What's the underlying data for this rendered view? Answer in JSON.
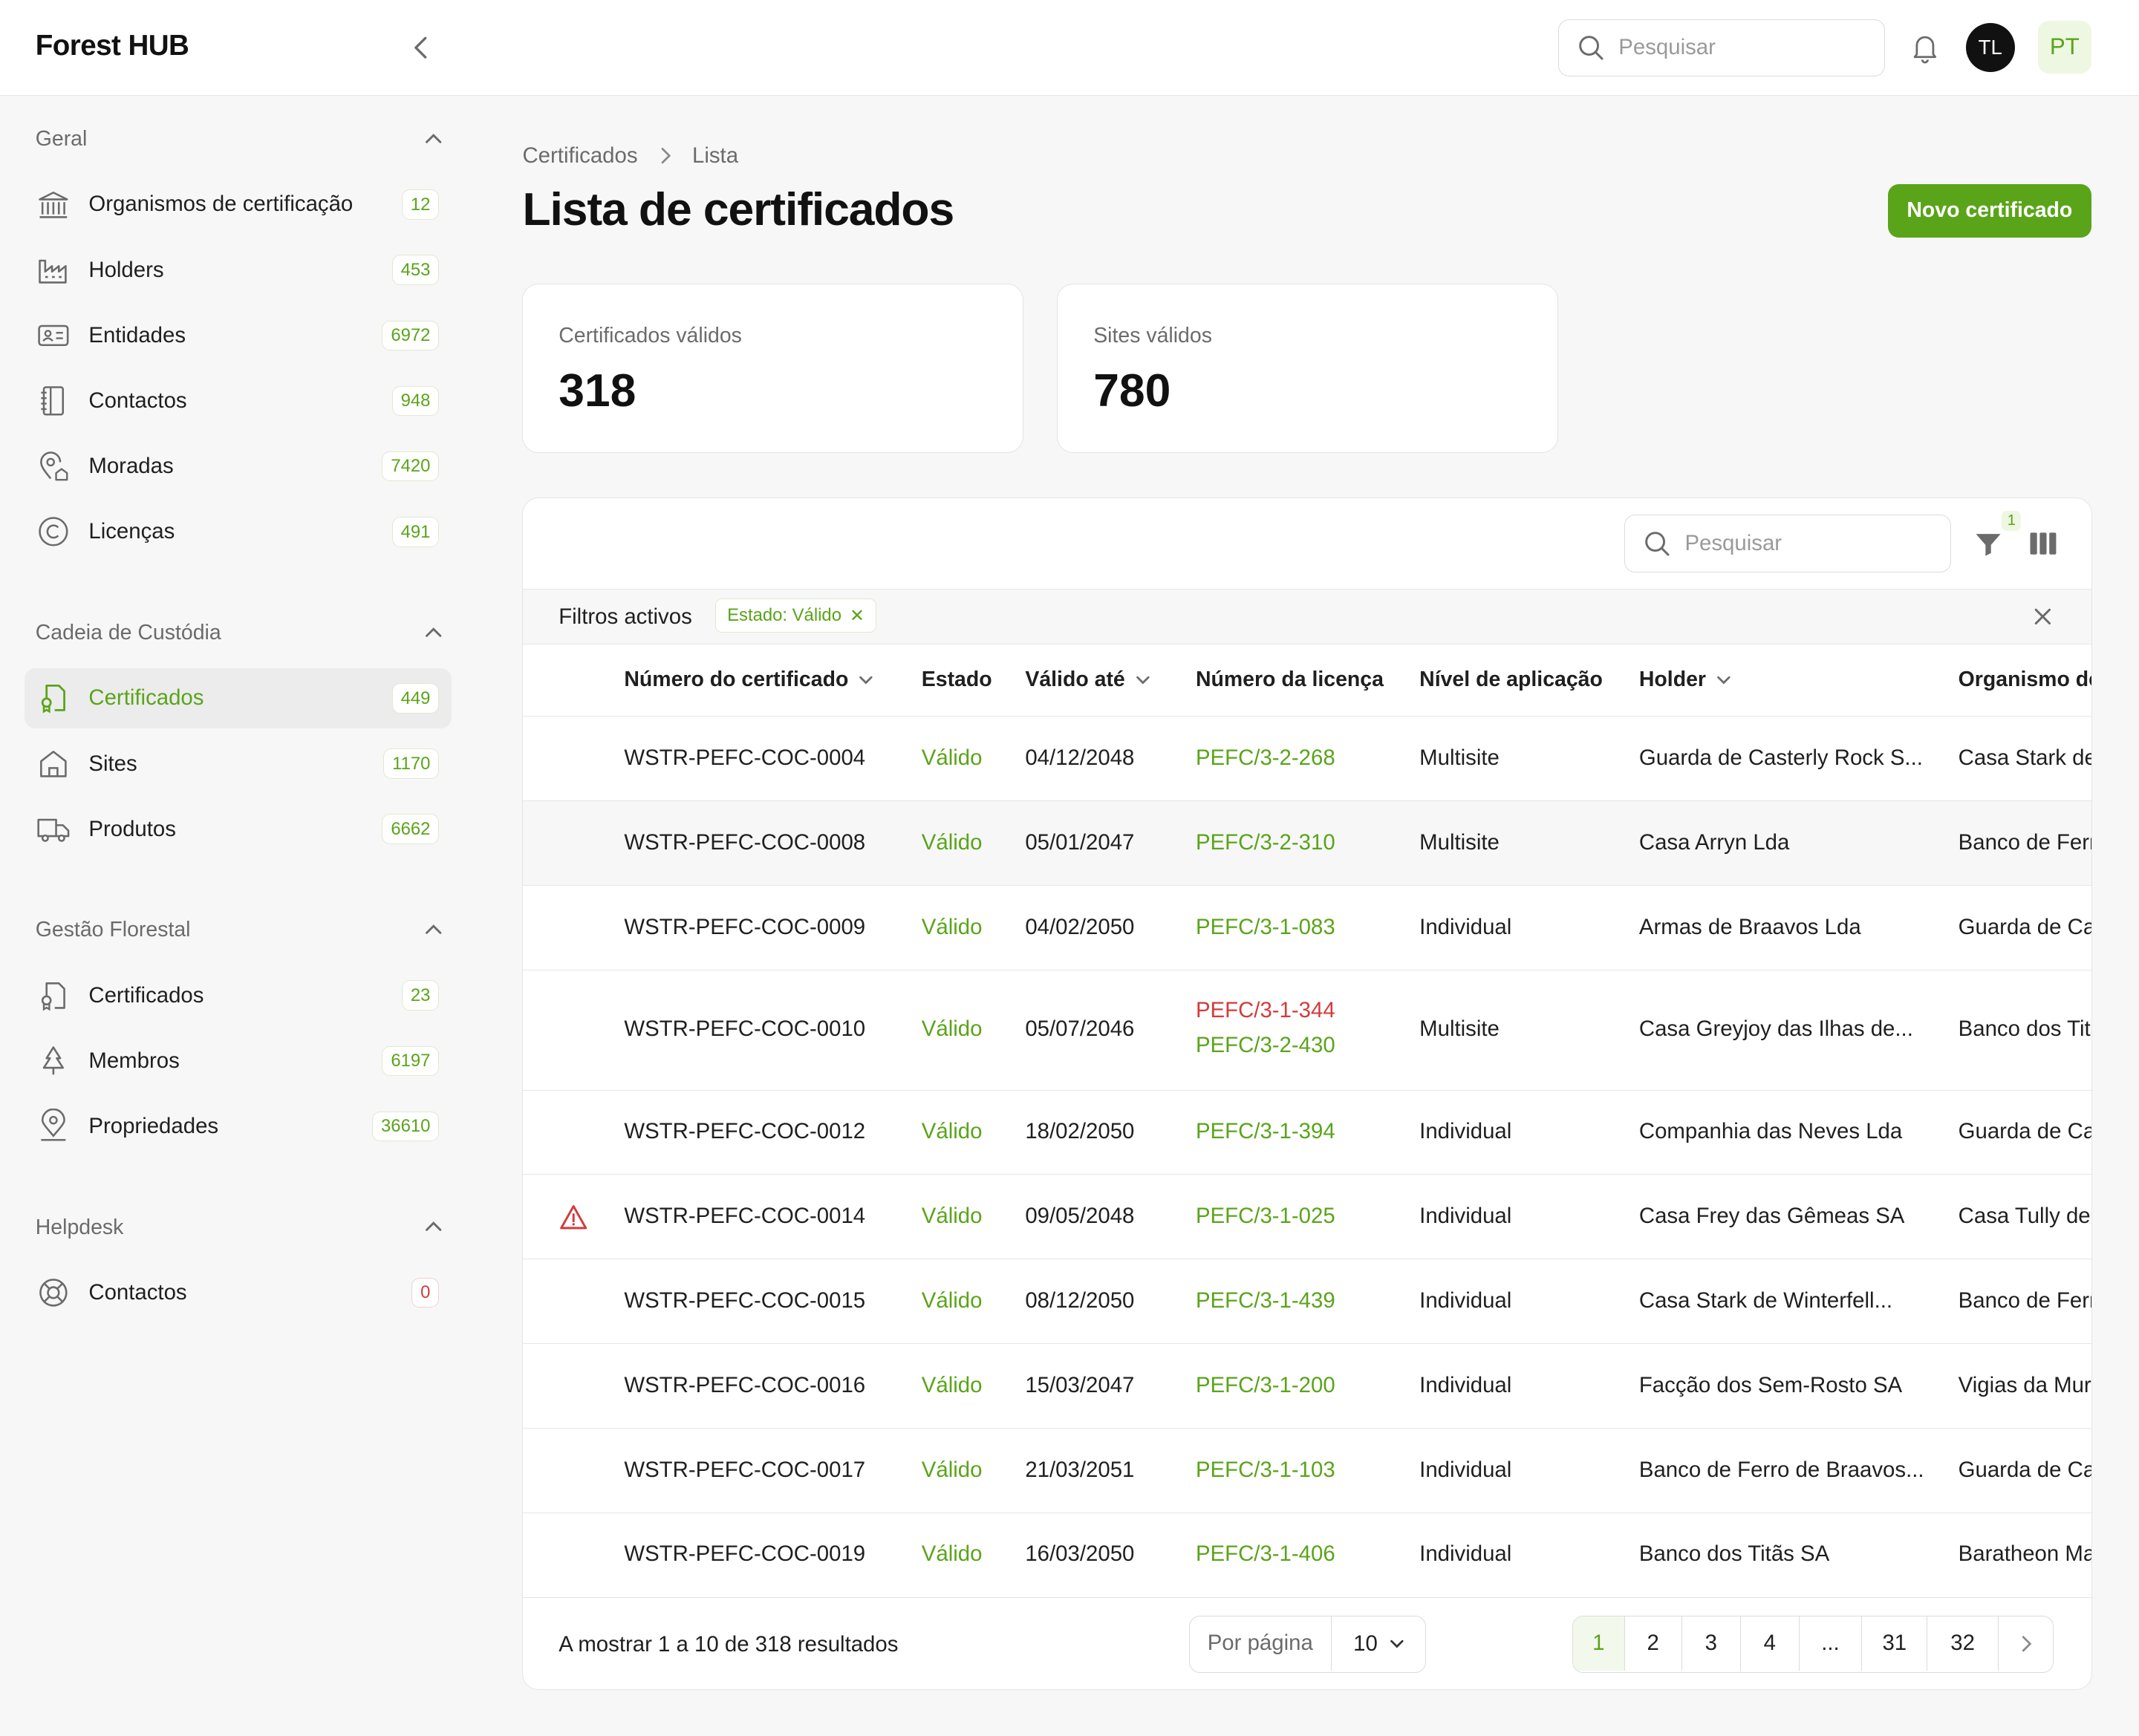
{
  "app": {
    "brand": "Forest HUB"
  },
  "header": {
    "search_placeholder": "Pesquisar",
    "user_initials": "TL",
    "language": "PT"
  },
  "sidebar": {
    "sections": [
      {
        "title": "Geral",
        "items": [
          {
            "label": "Organismos de certificação",
            "count": "12",
            "icon": "bank-icon"
          },
          {
            "label": "Holders",
            "count": "453",
            "icon": "factory-icon"
          },
          {
            "label": "Entidades",
            "count": "6972",
            "icon": "id-card-icon"
          },
          {
            "label": "Contactos",
            "count": "948",
            "icon": "address-book-icon"
          },
          {
            "label": "Moradas",
            "count": "7420",
            "icon": "location-home-icon"
          },
          {
            "label": "Licenças",
            "count": "491",
            "icon": "copyright-icon"
          }
        ]
      },
      {
        "title": "Cadeia de Custódia",
        "items": [
          {
            "label": "Certificados",
            "count": "449",
            "icon": "certificate-icon",
            "active": true
          },
          {
            "label": "Sites",
            "count": "1170",
            "icon": "house-icon"
          },
          {
            "label": "Produtos",
            "count": "6662",
            "icon": "truck-icon"
          }
        ]
      },
      {
        "title": "Gestão Florestal",
        "items": [
          {
            "label": "Certificados",
            "count": "23",
            "icon": "certificate-icon"
          },
          {
            "label": "Membros",
            "count": "6197",
            "icon": "tree-icon"
          },
          {
            "label": "Propriedades",
            "count": "36610",
            "icon": "location-user-icon"
          }
        ]
      },
      {
        "title": "Helpdesk",
        "items": [
          {
            "label": "Contactos",
            "count": "0",
            "icon": "lifebuoy-icon"
          }
        ]
      }
    ]
  },
  "breadcrumb": {
    "parent": "Certificados",
    "current": "Lista"
  },
  "page": {
    "title": "Lista de certificados",
    "new_button": "Novo certificado"
  },
  "stats": [
    {
      "label": "Certificados válidos",
      "value": "318"
    },
    {
      "label": "Sites válidos",
      "value": "780"
    }
  ],
  "table": {
    "search_placeholder": "Pesquisar",
    "filter_count": "1",
    "active_filters_label": "Filtros activos",
    "active_filter_chip": "Estado: Válido",
    "columns": [
      "Número do certificado",
      "Estado",
      "Válido até",
      "Número da licença",
      "Nível de aplicação",
      "Holder",
      "Organismo de certificação"
    ],
    "rows": [
      {
        "warning": false,
        "number": "WSTR-PEFC-COC-0004",
        "status": "Válido",
        "valid_until": "04/12/2048",
        "licenses": [
          {
            "code": "PEFC/3-2-268",
            "state": "ok"
          }
        ],
        "level": "Multisite",
        "holder": "Guarda de Casterly Rock S...",
        "org": "Casa Stark de Winterfell"
      },
      {
        "warning": false,
        "number": "WSTR-PEFC-COC-0008",
        "status": "Válido",
        "valid_until": "05/01/2047",
        "licenses": [
          {
            "code": "PEFC/3-2-310",
            "state": "ok"
          }
        ],
        "level": "Multisite",
        "holder": "Casa Arryn Lda",
        "org": "Banco de Ferro de Braavos"
      },
      {
        "warning": false,
        "number": "WSTR-PEFC-COC-0009",
        "status": "Válido",
        "valid_until": "04/02/2050",
        "licenses": [
          {
            "code": "PEFC/3-1-083",
            "state": "ok"
          }
        ],
        "level": "Individual",
        "holder": "Armas de Braavos Lda",
        "org": "Guarda de Casterly Rock"
      },
      {
        "warning": false,
        "number": "WSTR-PEFC-COC-0010",
        "status": "Válido",
        "valid_until": "05/07/2046",
        "licenses": [
          {
            "code": "PEFC/3-1-344",
            "state": "error"
          },
          {
            "code": "PEFC/3-2-430",
            "state": "ok"
          }
        ],
        "level": "Multisite",
        "holder": "Casa Greyjoy das Ilhas de...",
        "org": "Banco dos Titãs"
      },
      {
        "warning": false,
        "number": "WSTR-PEFC-COC-0012",
        "status": "Válido",
        "valid_until": "18/02/2050",
        "licenses": [
          {
            "code": "PEFC/3-1-394",
            "state": "ok"
          }
        ],
        "level": "Individual",
        "holder": "Companhia das Neves Lda",
        "org": "Guarda de Casterly Rock"
      },
      {
        "warning": true,
        "number": "WSTR-PEFC-COC-0014",
        "status": "Válido",
        "valid_until": "09/05/2048",
        "licenses": [
          {
            "code": "PEFC/3-1-025",
            "state": "ok"
          }
        ],
        "level": "Individual",
        "holder": "Casa Frey das Gêmeas SA",
        "org": "Casa Tully de Correrrio"
      },
      {
        "warning": false,
        "number": "WSTR-PEFC-COC-0015",
        "status": "Válido",
        "valid_until": "08/12/2050",
        "licenses": [
          {
            "code": "PEFC/3-1-439",
            "state": "ok"
          }
        ],
        "level": "Individual",
        "holder": "Casa Stark de Winterfell...",
        "org": "Banco de Ferro de Braavos"
      },
      {
        "warning": false,
        "number": "WSTR-PEFC-COC-0016",
        "status": "Válido",
        "valid_until": "15/03/2047",
        "licenses": [
          {
            "code": "PEFC/3-1-200",
            "state": "ok"
          }
        ],
        "level": "Individual",
        "holder": "Facção dos Sem-Rosto SA",
        "org": "Vigias da Muralha"
      },
      {
        "warning": false,
        "number": "WSTR-PEFC-COC-0017",
        "status": "Válido",
        "valid_until": "21/03/2051",
        "licenses": [
          {
            "code": "PEFC/3-1-103",
            "state": "ok"
          }
        ],
        "level": "Individual",
        "holder": "Banco de Ferro de Braavos...",
        "org": "Guarda de Casterly Rock"
      },
      {
        "warning": false,
        "number": "WSTR-PEFC-COC-0019",
        "status": "Válido",
        "valid_until": "16/03/2050",
        "licenses": [
          {
            "code": "PEFC/3-1-406",
            "state": "ok"
          }
        ],
        "level": "Individual",
        "holder": "Banco dos Titãs SA",
        "org": "Baratheon Madeiras"
      }
    ],
    "footer": {
      "results_text": "A mostrar 1 a 10 de 318 resultados",
      "per_page_label": "Por página",
      "per_page_value": "10",
      "pages": [
        "1",
        "2",
        "3",
        "4",
        "...",
        "31",
        "32"
      ],
      "current_page": "1"
    }
  },
  "colors": {
    "accent": "#5aa41a",
    "danger": "#d43b3b",
    "text": "#1f1f1f",
    "muted": "#6b6b6b"
  }
}
